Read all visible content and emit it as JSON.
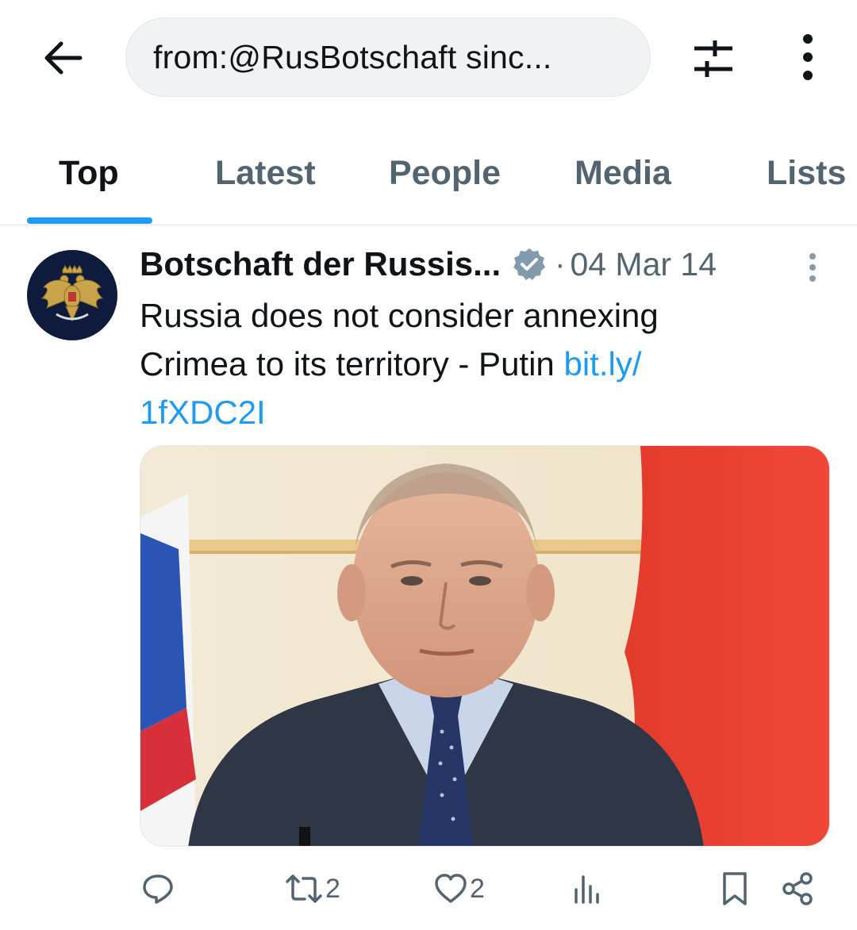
{
  "header": {
    "search_value": "from:@RusBotschaft sinc...",
    "back_icon": "back-arrow-icon",
    "filter_icon": "filter-sliders-icon",
    "more_icon": "more-vertical-icon"
  },
  "tabs": [
    {
      "label": "Top",
      "active": true
    },
    {
      "label": "Latest",
      "active": false
    },
    {
      "label": "People",
      "active": false
    },
    {
      "label": "Media",
      "active": false
    },
    {
      "label": "Lists",
      "active": false
    }
  ],
  "tweet": {
    "author": "Botschaft der Russis...",
    "verified": true,
    "separator": "·",
    "date": "04 Mar 14",
    "text_line1": "Russia does not consider annexing",
    "text_line2": "Crimea to its territory - Putin ",
    "link_part1": "bit.ly/",
    "link_part2": "1fXDC2I",
    "actions": {
      "reply_count": "",
      "retweet_count": "2",
      "like_count": "2",
      "views_count": ""
    }
  },
  "colors": {
    "accent": "#1d9bf0",
    "secondary_text": "#536471",
    "primary_text": "#0f1419"
  }
}
